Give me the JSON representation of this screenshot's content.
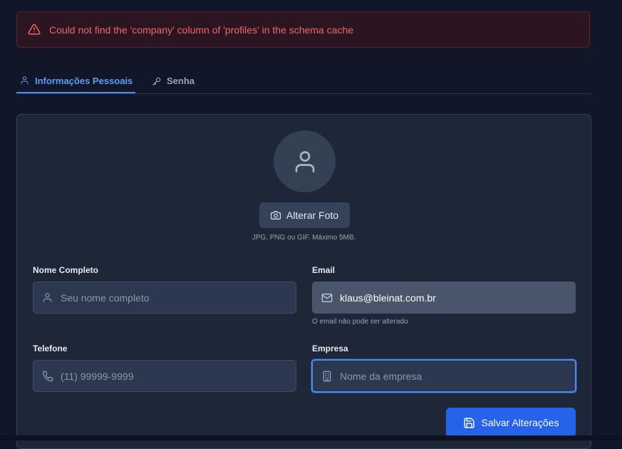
{
  "alert": {
    "icon": "warning-triangle-icon",
    "message": "Could not find the 'company' column of 'profiles' in the schema cache",
    "color": "#f06470"
  },
  "tabs": [
    {
      "label": "Informações Pessoais",
      "icon": "user-icon",
      "active": true
    },
    {
      "label": "Senha",
      "icon": "key-icon",
      "active": false
    }
  ],
  "profile": {
    "avatar_icon": "user-icon",
    "change_photo_label": "Alterar Foto",
    "change_photo_icon": "camera-icon",
    "photo_hint": "JPG, PNG ou GIF. Máximo 5MB."
  },
  "form": {
    "full_name": {
      "label": "Nome Completo",
      "value": "",
      "placeholder": "Seu nome completo",
      "icon": "user-icon"
    },
    "email": {
      "label": "Email",
      "value": "klaus@bleinat.com.br",
      "placeholder": "",
      "icon": "mail-icon",
      "hint": "O email não pode ser alterado",
      "disabled": true
    },
    "phone": {
      "label": "Telefone",
      "value": "",
      "placeholder": "(11) 99999-9999",
      "icon": "phone-icon"
    },
    "company": {
      "label": "Empresa",
      "value": "",
      "placeholder": "Nome da empresa",
      "icon": "building-icon",
      "focused": true
    }
  },
  "actions": {
    "save_label": "Salvar Alterações",
    "save_icon": "save-icon",
    "accent": "#2563eb"
  }
}
